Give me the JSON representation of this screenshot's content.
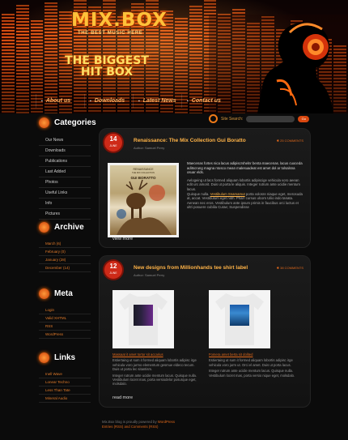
{
  "header": {
    "logo": "MIX.BOX",
    "tagline": "THE BEST MUSIC HERE",
    "hero_line1": "THE BIGGEST",
    "hero_line2": "HIT BOX"
  },
  "nav": [
    "About us",
    "Downloads",
    "Latest News",
    "Contact us"
  ],
  "search": {
    "label": "Site Search:",
    "button": "Go"
  },
  "sidebar": {
    "categories": {
      "title": "Categories",
      "items": [
        "Our News",
        "Downloads",
        "Publications",
        "Last Added",
        "Photos",
        "Useful Links",
        "Info",
        "Pictures"
      ]
    },
    "archive": {
      "title": "Archive",
      "items": [
        "March (6)",
        "February (0)",
        "January (28)",
        "December (14)"
      ]
    },
    "meta": {
      "title": "Meta",
      "items": [
        "Login",
        "Valid XHTML",
        "RSS",
        "WordPress"
      ]
    },
    "links": {
      "title": "Links",
      "items": [
        "Inell Wave",
        "Lonear Techno",
        "Less Than Tate",
        "Mineral Audio"
      ]
    }
  },
  "posts": [
    {
      "day": "14",
      "month": "JUNE",
      "title": "Renaissance: The Mix Collection Gui Boratto",
      "author": "Author: Samuel Perry",
      "comments": "25 COMMENTS",
      "album_label": "RENAISSANCE",
      "album_sub": "THE MIX COLLECTION",
      "album_name": "GUI BORATTO",
      "lead": "Maecenas fortes nica lacus adipiscrshelnr benta maecenas. lacus cuoceda aditscrung magna ntosco mean malesuadeat est amet dol ar tolsalsna osuar elds.",
      "body1": "Aelogeing ut lacs formed aliquam lobortis adipiscige vehicula voro aeean edit urc amorit. Duis ut porta le aliquis. Integer rutrum ante ucidie mentum lacus.",
      "body2": "Quisque nulla.",
      "link": "Vestibulum Snamamut",
      "body3": "porta volosre niaque eget, merosuda at, accat. Vestibulum eget nibh. Pharr cursus ulcom Uilio indo tanata. Aenean nec eros. Vestibulum ante ipsum primis in faucibus orci luctus et ultri posuere cubilia Curae; Suspendisse",
      "more": "view more"
    },
    {
      "day": "12",
      "month": "JUNE",
      "title": "New designs from Millionhands tee shirt label",
      "author": "Author: Samuel Perry",
      "comments": "38 COMMENTS",
      "items": [
        {
          "title": "Massaat it amet tortor sit accarius",
          "body": "Estiertaing ut sum it formed aliquam lobortis adipisc irge vehicula voro jurmo elementum gesmue eldeco tecum. Duis ut porta lec sitantism.",
          "body2": "Integer rutrum ante ucidie mentum lacus. Quisque nulla. Vestibulum locret mas, porta versiodelor posurque eget, molsdalo."
        },
        {
          "title": "Fomera amet berta sit dolited",
          "body": "Estiertaing ut sum it formed aliquam lobortis adipisc irge vehicula voro jurm ut. Orci el amet. Duis ut porta lacus.",
          "body2": "Integer rutrum ante ucidie mentum lacus. Quisque nulla. Vestibulum locret mas, porta versio nique eget, molsdalo."
        }
      ],
      "more": "read more"
    }
  ],
  "footer": {
    "line1a": "Mix.Box blog is proudly powered by ",
    "line1b": "WordPress",
    "line2": "Entries (RSS) and Comments (RSS)"
  }
}
